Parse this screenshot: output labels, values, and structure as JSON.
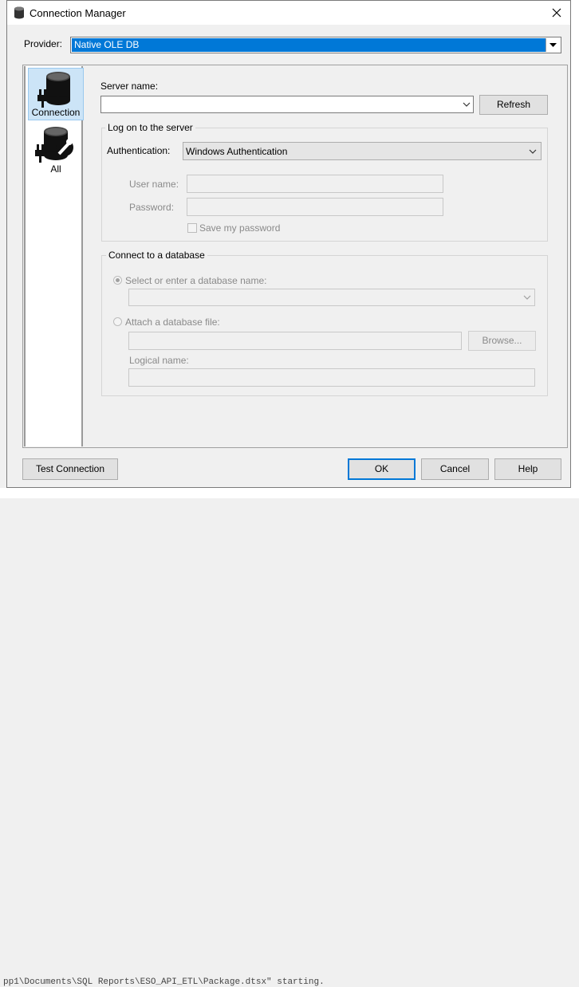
{
  "window": {
    "title": "Connection Manager"
  },
  "provider": {
    "label": "Provider:",
    "value": "Native OLE DB"
  },
  "sidebar": {
    "items": [
      {
        "label": "Connection"
      },
      {
        "label": "All"
      }
    ]
  },
  "server": {
    "label": "Server name:",
    "value": "",
    "refresh_label": "Refresh"
  },
  "logon": {
    "group_title": "Log on to the server",
    "auth_label": "Authentication:",
    "auth_value": "Windows Authentication",
    "user_label": "User name:",
    "user_value": "",
    "password_label": "Password:",
    "password_value": "",
    "save_password_label": "Save my password"
  },
  "database": {
    "group_title": "Connect to a database",
    "select_option_label": "Select or enter a database name:",
    "select_value": "",
    "attach_option_label": "Attach a database file:",
    "attach_value": "",
    "browse_label": "Browse...",
    "logical_name_label": "Logical name:",
    "logical_name_value": ""
  },
  "footer": {
    "test_label": "Test Connection",
    "ok_label": "OK",
    "cancel_label": "Cancel",
    "help_label": "Help"
  },
  "background": {
    "output_text": "pp1\\Documents\\SQL Reports\\ESO_API_ETL\\Package.dtsx\" starting."
  },
  "colors": {
    "selection": "#0078d7",
    "sidebar_selected": "#cce4f7"
  },
  "icons": [
    "database-icon",
    "connection-plug-icon",
    "wrench-icon",
    "chevron-down-icon",
    "close-icon"
  ]
}
